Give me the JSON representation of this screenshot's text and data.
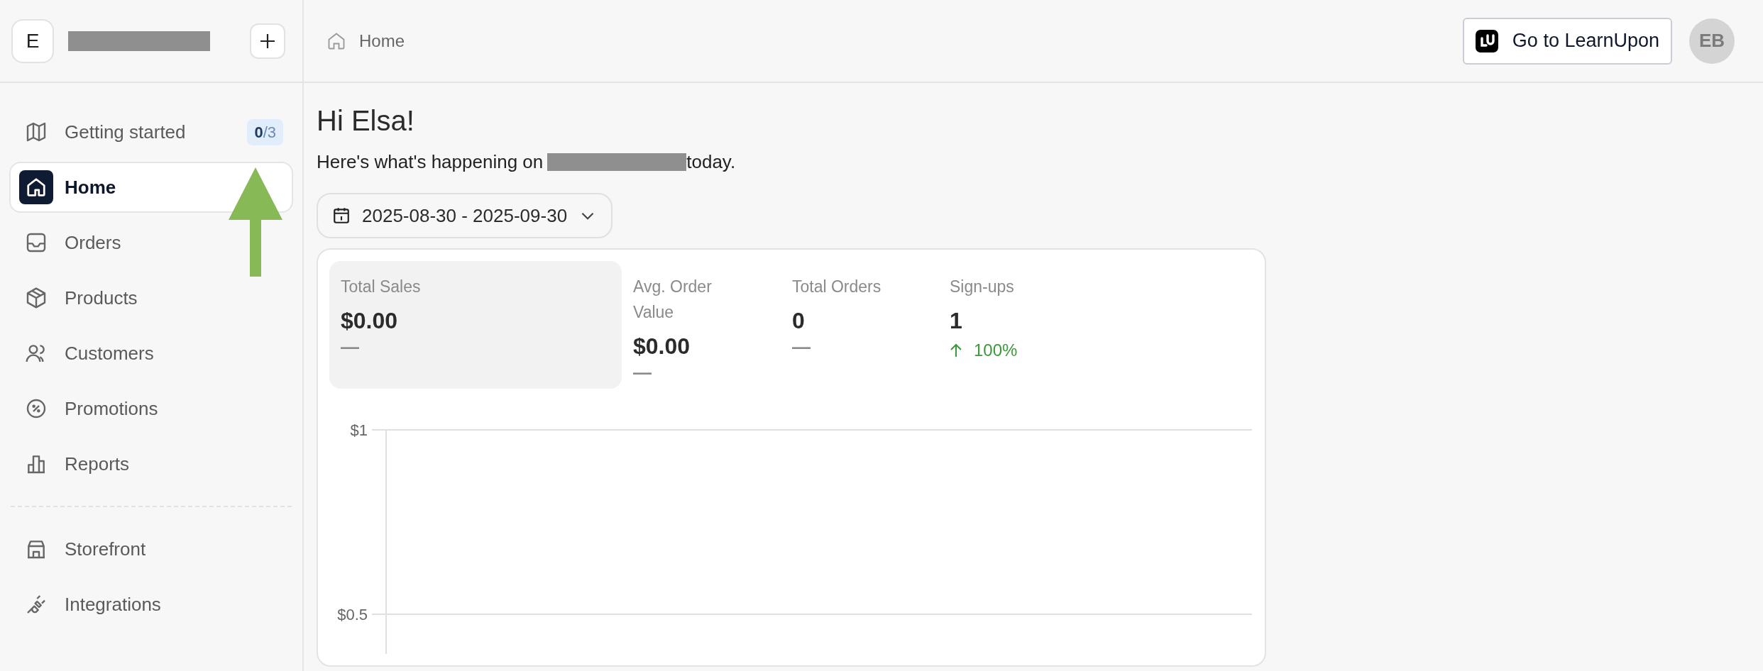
{
  "workspace": {
    "initial": "E"
  },
  "sidebar": {
    "sections": [
      {
        "items": [
          {
            "label": "Getting started",
            "selected": false,
            "badge": {
              "done": "0",
              "total": "/3"
            }
          },
          {
            "label": "Home",
            "selected": true
          },
          {
            "label": "Orders",
            "selected": false
          },
          {
            "label": "Products",
            "selected": false
          },
          {
            "label": "Customers",
            "selected": false
          },
          {
            "label": "Promotions",
            "selected": false
          },
          {
            "label": "Reports",
            "selected": false
          }
        ]
      },
      {
        "items": [
          {
            "label": "Storefront",
            "selected": false
          },
          {
            "label": "Integrations",
            "selected": false
          }
        ]
      }
    ]
  },
  "header": {
    "breadcrumb": "Home",
    "button": "Go to LearnUpon",
    "avatar": "EB"
  },
  "greeting": {
    "title": "Hi Elsa!",
    "before": "Here's what's happening on",
    "after": "today."
  },
  "date_range": "2025-08-30 - 2025-09-30",
  "stats": [
    {
      "label": "Total Sales",
      "value": "$0.00",
      "selected": true,
      "change": {
        "kind": "flat",
        "text": "—"
      }
    },
    {
      "label": "Avg. Order Value",
      "value": "$0.00",
      "selected": false,
      "change": {
        "kind": "flat",
        "text": "—"
      }
    },
    {
      "label": "Total Orders",
      "value": "0",
      "selected": false,
      "change": {
        "kind": "flat",
        "text": "—"
      }
    },
    {
      "label": "Sign-ups",
      "value": "1",
      "selected": false,
      "change": {
        "kind": "up",
        "text": "100%"
      }
    }
  ],
  "chart": {
    "y_labels": [
      "$1",
      "$0.5"
    ]
  }
}
